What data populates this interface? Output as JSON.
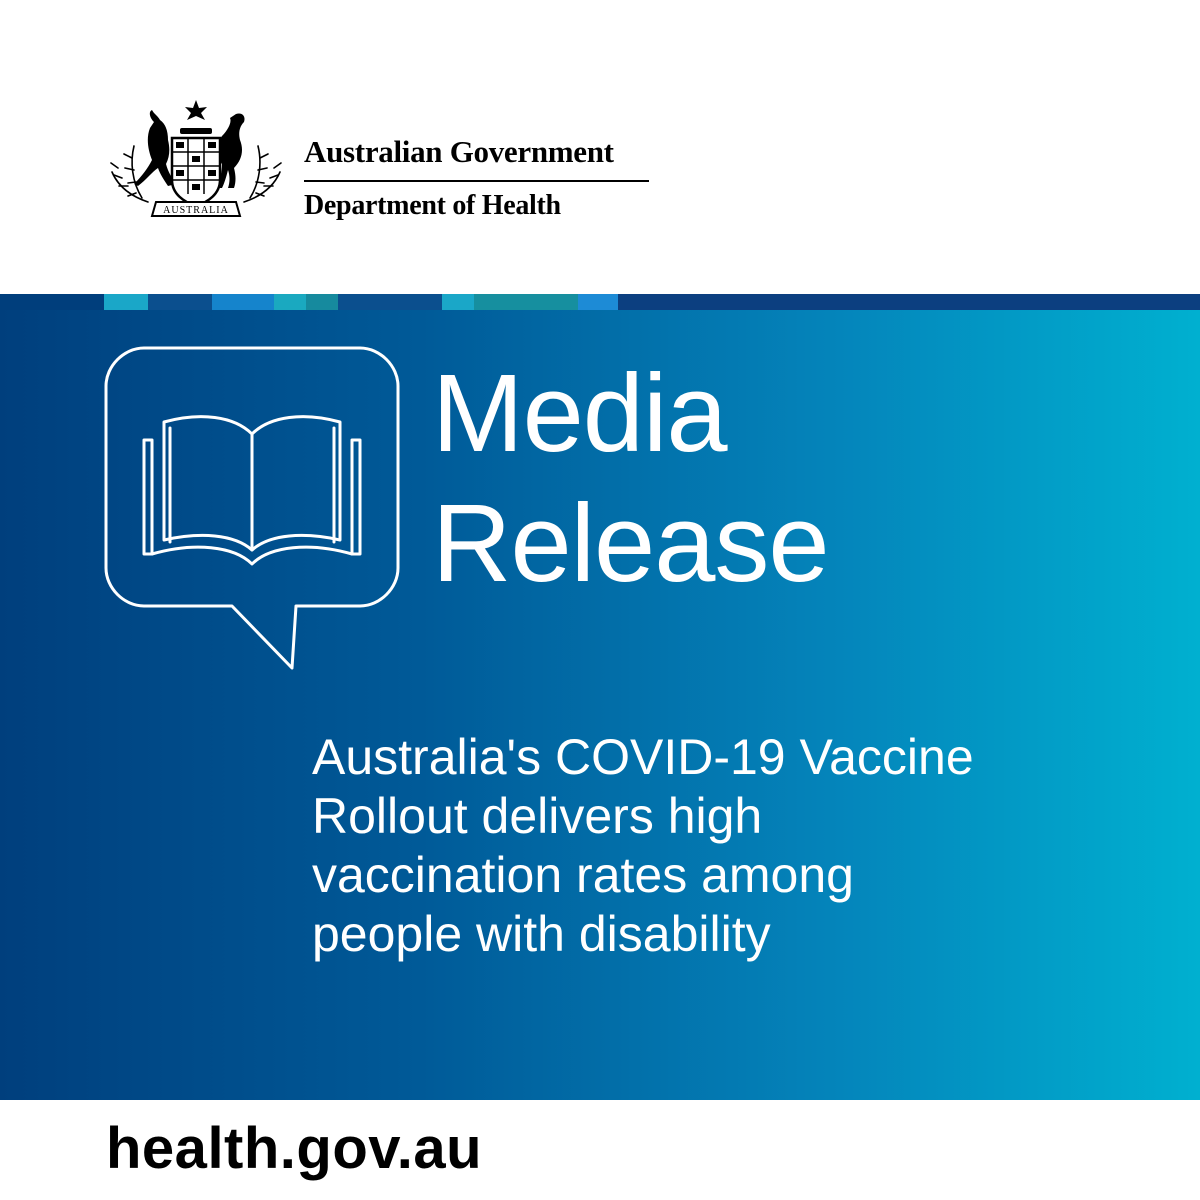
{
  "branding": {
    "government": "Australian Government",
    "department": "Department of Health",
    "crest_text": "AUSTRALIA"
  },
  "release": {
    "title_line_1": "Media",
    "title_line_2": "Release",
    "headline_lines": [
      "Australia's COVID-19 Vaccine",
      "Rollout delivers high",
      "vaccination rates among",
      "people with disability"
    ]
  },
  "footer": {
    "website": "health.gov.au"
  },
  "icons": {
    "speech": "speech-bubble-icon",
    "book": "open-book-icon",
    "crest": "coat-of-arms-icon"
  },
  "colors": {
    "banner_dark": "#003f7d",
    "banner_light": "#00b0d0",
    "text_on_banner": "#ffffff",
    "text_dark": "#000000"
  }
}
